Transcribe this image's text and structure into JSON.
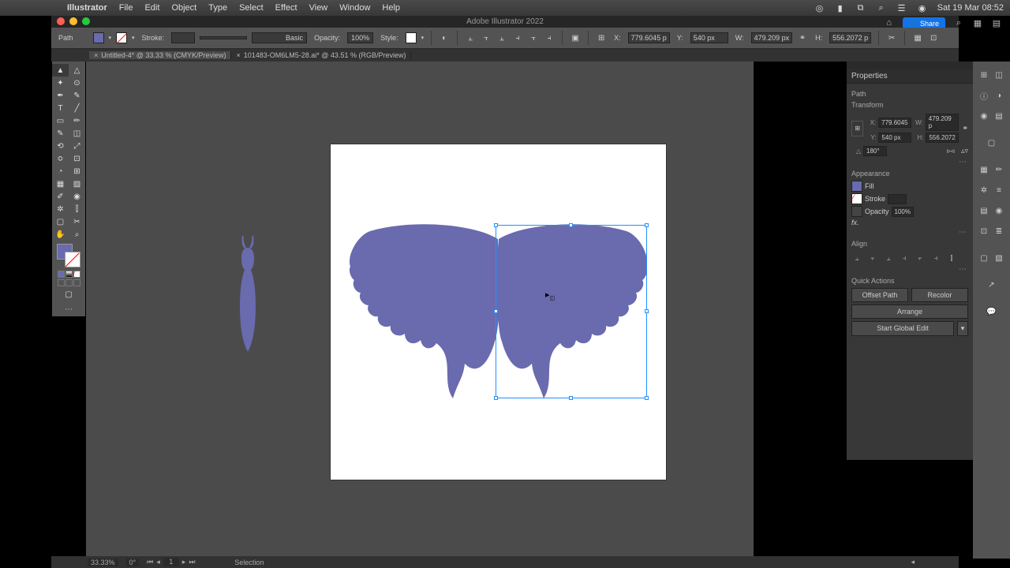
{
  "menubar": {
    "app": "Illustrator",
    "items": [
      "File",
      "Edit",
      "Object",
      "Type",
      "Select",
      "Effect",
      "View",
      "Window",
      "Help"
    ],
    "clock": "Sat 19 Mar 08:52"
  },
  "app": {
    "title": "Adobe Illustrator 2022",
    "share": "Share"
  },
  "ctrlbar": {
    "sel_label": "Path",
    "stroke_label": "Stroke:",
    "stroke_weight": "",
    "brush": "Basic",
    "opacity_label": "Opacity:",
    "opacity": "100%",
    "style_label": "Style:",
    "x_label": "X:",
    "x": "779.6045 p",
    "y_label": "Y:",
    "y": "540 px",
    "w_label": "W:",
    "w": "479.209 px",
    "h_label": "H:",
    "h": "556.2072 p"
  },
  "tabs": [
    {
      "label": "Untitled-4* @ 33.33 % (CMYK/Preview)",
      "active": true
    },
    {
      "label": "101483-OM6LM5-28.ai* @ 43.51 % (RGB/Preview)",
      "active": false
    }
  ],
  "tooltab": "Properties",
  "properties": {
    "sel_type": "Path",
    "transform": {
      "title": "Transform",
      "x_label": "X:",
      "x": "779.6045",
      "y_label": "Y:",
      "y": "540 px",
      "w_label": "W:",
      "w": "479.209 p",
      "h_label": "H:",
      "h": "556.2072",
      "angle_label": "△",
      "angle": "180°"
    },
    "appearance": {
      "title": "Appearance",
      "fill_label": "Fill",
      "stroke_label": "Stroke",
      "stroke_val": "",
      "opacity_label": "Opacity",
      "opacity": "100%",
      "fx": "fx."
    },
    "align_title": "Align",
    "quick_title": "Quick Actions",
    "offset": "Offset Path",
    "recolor": "Recolor",
    "arrange": "Arrange",
    "globaledit": "Start Global Edit"
  },
  "statusbar": {
    "zoom": "33.33%",
    "angle": "0°",
    "page": "1",
    "mode": "Selection"
  },
  "colors": {
    "shape": "#6a6aaf"
  }
}
